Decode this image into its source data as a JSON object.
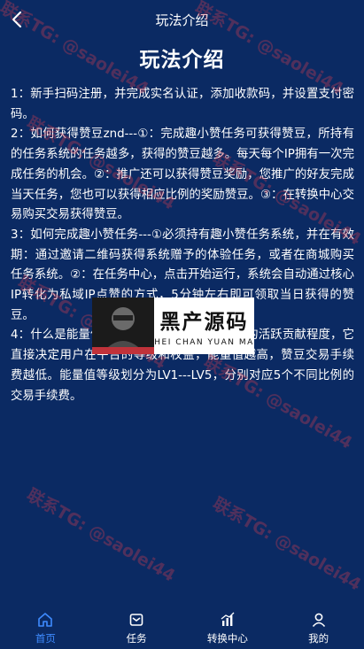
{
  "header": {
    "title": "玩法介绍"
  },
  "main": {
    "heading": "玩法介绍",
    "paragraphs": [
      "1：新手扫码注册，并完成实名认证，添加收款码，并设置支付密码。",
      "2：如何获得赞豆znd---①：完成趣小赞任务可获得赞豆，所持有的任务系统的任务越多，获得的赞豆越多。每天每个IP拥有一次完成任务的机会。②：推广还可以获得赞豆奖励，您推广的好友完成当天任务，您也可以获得相应比例的奖励赞豆。③：在转换中心交易购买交易获得赞豆。",
      "3：如何完成趣小赞任务---①必须持有趣小赞任务系统，并在有效期：通过邀请二维码获得系统赠予的体验任务，或者在商城购买任务系统。②：在任务中心，点击开始运行，系统会自动通过核心IP转化为私域IP点赞的方式，5分钟左右即可领取当日获得的赞豆。",
      "4：什么是能量值：能量值代表用户在平台中的活跃贡献程度，它直接决定用户在平台的等级和权益，能量值越高，赞豆交易手续费越低。能量值等级划分为LV1---LV5，分别对应5个不同比例的交易手续费。"
    ]
  },
  "watermark": {
    "text": "联系TG: @saolei44",
    "color": "#d23c50"
  },
  "logo": {
    "cn": "黑产源码",
    "en": "HEI CHAN YUAN MA"
  },
  "tabbar": {
    "items": [
      {
        "label": "首页",
        "icon": "home-icon"
      },
      {
        "label": "任务",
        "icon": "task-icon"
      },
      {
        "label": "转换中心",
        "icon": "chart-icon"
      },
      {
        "label": "我的",
        "icon": "user-icon"
      }
    ],
    "active_color": "#3e8bff"
  },
  "colors": {
    "background": "#0b2a63",
    "text": "#ffffff"
  }
}
